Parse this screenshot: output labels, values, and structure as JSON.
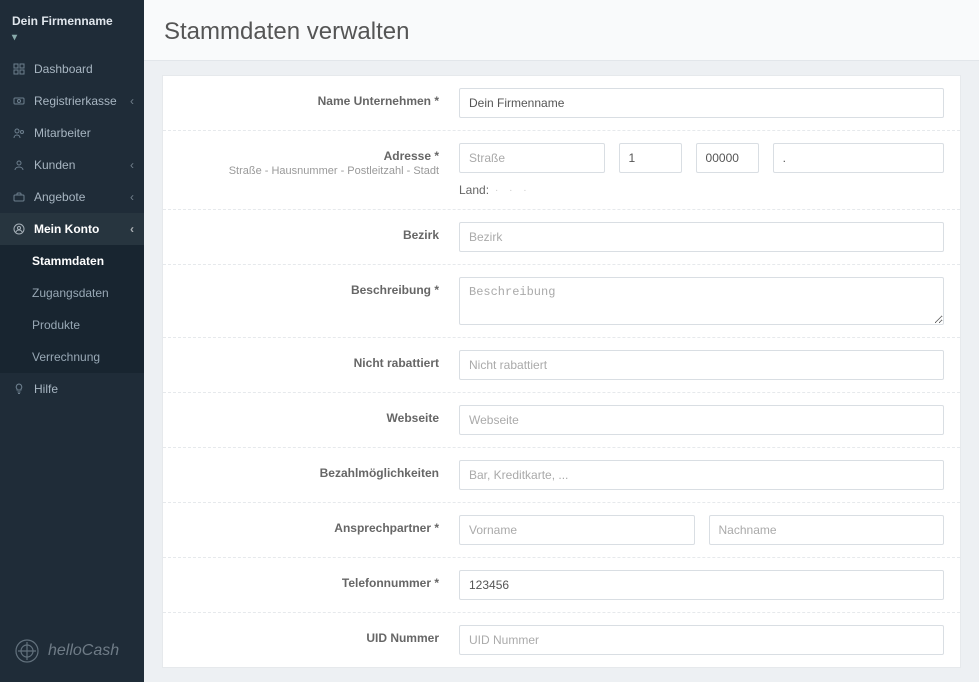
{
  "company": {
    "name": "Dein Firmenname",
    "caret": "▾"
  },
  "nav": {
    "dashboard": "Dashboard",
    "register": "Registrierkasse",
    "employees": "Mitarbeiter",
    "customers": "Kunden",
    "offers": "Angebote",
    "account": "Mein Konto",
    "sub": {
      "stammdaten": "Stammdaten",
      "zugang": "Zugangsdaten",
      "produkte": "Produkte",
      "verrechnung": "Verrechnung"
    },
    "help": "Hilfe"
  },
  "logo": "helloCash",
  "page": {
    "title": "Stammdaten verwalten"
  },
  "form": {
    "nameLabel": "Name Unternehmen *",
    "nameValue": "Dein Firmenname",
    "addrLabel": "Adresse *",
    "addrHint": "Straße - Hausnummer - Postleitzahl - Stadt",
    "streetPh": "Straße",
    "numVal": "1",
    "zipVal": "00000",
    "cityVal": ".",
    "landLabel": "Land:",
    "bezirkLabel": "Bezirk",
    "bezirkPh": "Bezirk",
    "descLabel": "Beschreibung *",
    "descPh": "Beschreibung",
    "rabattLabel": "Nicht rabattiert",
    "rabattPh": "Nicht rabattiert",
    "webLabel": "Webseite",
    "webPh": "Webseite",
    "payLabel": "Bezahlmöglichkeiten",
    "payPh": "Bar, Kreditkarte, ...",
    "contactLabel": "Ansprechpartner *",
    "firstPh": "Vorname",
    "lastPh": "Nachname",
    "phoneLabel": "Telefonnummer *",
    "phoneVal": "123456",
    "uidLabel": "UID Nummer",
    "uidPh": "UID Nummer"
  }
}
